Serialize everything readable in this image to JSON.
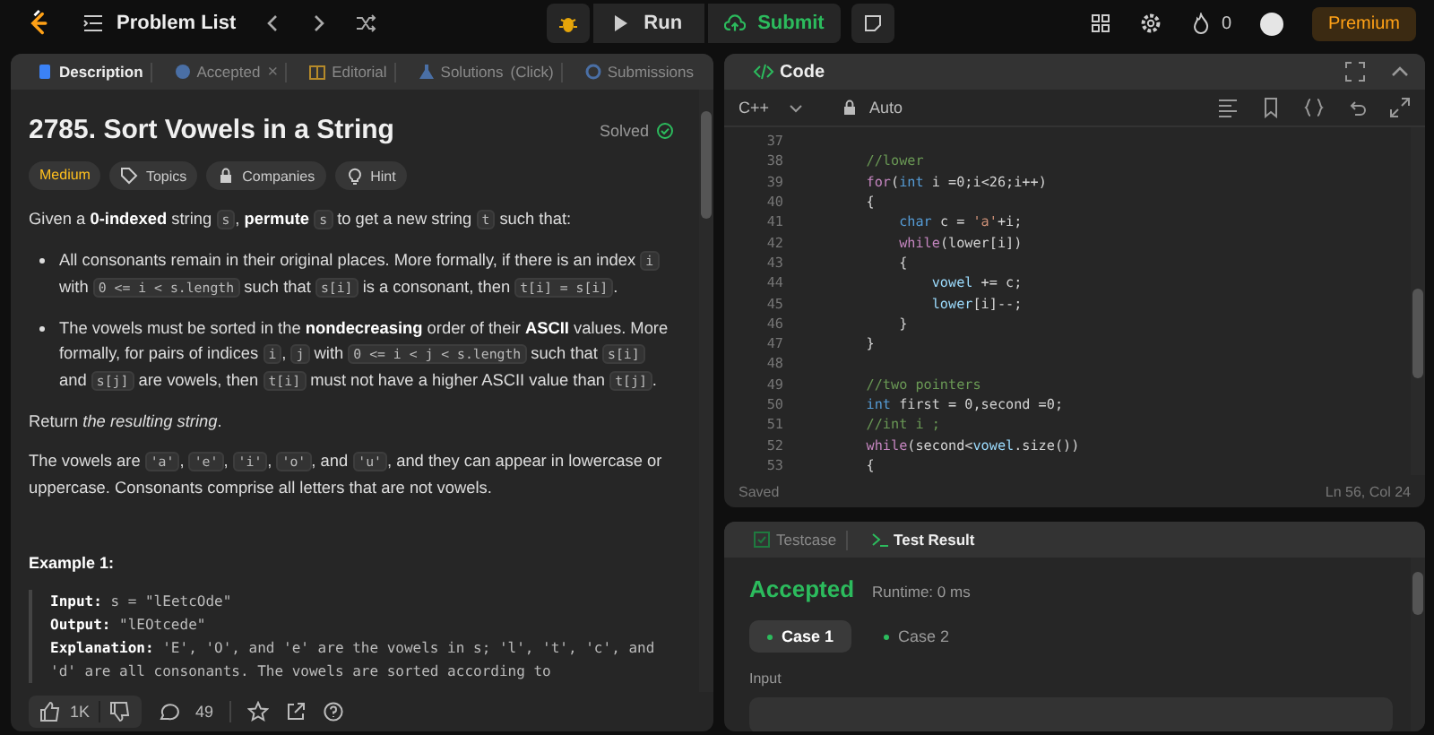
{
  "top_bar": {
    "nav_label": "Problem List",
    "run_label": "Run",
    "submit_label": "Submit",
    "streak": "0",
    "premium_label": "Premium"
  },
  "description_panel": {
    "tabs": [
      {
        "label": "Description",
        "selected": true,
        "kind": "description"
      },
      {
        "label": "Accepted",
        "selected": false,
        "kind": "accepted",
        "close_label": "×"
      },
      {
        "label": "Editorial",
        "selected": false,
        "kind": "editorial"
      },
      {
        "label": "Solutions",
        "selected": false,
        "kind": "solutions",
        "extra": "(Click)"
      },
      {
        "label": "Submissions",
        "selected": false,
        "kind": "submissions"
      }
    ],
    "title": "2785. Sort Vowels in a String",
    "status": "Solved",
    "tags": [
      {
        "label": "Medium",
        "kind": "difficulty"
      },
      {
        "label": "Topics",
        "kind": "topics"
      },
      {
        "label": "Companies",
        "kind": "companies"
      },
      {
        "label": "Hint",
        "kind": "hint"
      }
    ],
    "blocks": [
      {
        "kind": "paragraph",
        "segments": [
          {
            "text": "Given a ",
            "kind": "plain"
          },
          {
            "text": "0-indexed",
            "kind": "bold"
          },
          {
            "text": " string ",
            "kind": "plain"
          },
          {
            "text": "s",
            "kind": "code"
          },
          {
            "text": ", ",
            "kind": "plain"
          },
          {
            "text": "permute ",
            "kind": "bold"
          },
          {
            "text": "s",
            "kind": "code"
          },
          {
            "text": " to get a new string ",
            "kind": "plain"
          },
          {
            "text": "t",
            "kind": "code"
          },
          {
            "text": " such that:",
            "kind": "plain"
          }
        ]
      },
      {
        "kind": "bullet",
        "segments": [
          {
            "text": "All consonants remain in their original places. More formally, if there is an index ",
            "kind": "plain"
          },
          {
            "text": "i",
            "kind": "code"
          },
          {
            "text": " with ",
            "kind": "plain"
          },
          {
            "text": "0 <= i < s.length",
            "kind": "code"
          },
          {
            "text": " such that ",
            "kind": "plain"
          },
          {
            "text": "s[i]",
            "kind": "code"
          },
          {
            "text": " is a consonant, then ",
            "kind": "plain"
          },
          {
            "text": "t[i] = s[i]",
            "kind": "code"
          },
          {
            "text": ".",
            "kind": "plain"
          }
        ]
      },
      {
        "kind": "bullet",
        "segments": [
          {
            "text": "The vowels must be sorted in the ",
            "kind": "plain"
          },
          {
            "text": "nondecreasing",
            "kind": "bold"
          },
          {
            "text": " order of their ",
            "kind": "plain"
          },
          {
            "text": "ASCII",
            "kind": "bold"
          },
          {
            "text": " values. More formally, for pairs of indices ",
            "kind": "plain"
          },
          {
            "text": "i",
            "kind": "code"
          },
          {
            "text": ", ",
            "kind": "plain"
          },
          {
            "text": "j",
            "kind": "code"
          },
          {
            "text": " with ",
            "kind": "plain"
          },
          {
            "text": "0 <= i < j < s.length",
            "kind": "code"
          },
          {
            "text": " such that ",
            "kind": "plain"
          },
          {
            "text": "s[i]",
            "kind": "code"
          },
          {
            "text": " and ",
            "kind": "plain"
          },
          {
            "text": "s[j]",
            "kind": "code"
          },
          {
            "text": " are vowels, then ",
            "kind": "plain"
          },
          {
            "text": "t[i]",
            "kind": "code"
          },
          {
            "text": " must not have a higher ASCII value than ",
            "kind": "plain"
          },
          {
            "text": "t[j]",
            "kind": "code"
          },
          {
            "text": ".",
            "kind": "plain"
          }
        ]
      },
      {
        "kind": "paragraph",
        "segments": [
          {
            "text": "Return ",
            "kind": "plain"
          },
          {
            "text": "the resulting string",
            "kind": "italic"
          },
          {
            "text": ".",
            "kind": "plain"
          }
        ]
      },
      {
        "kind": "paragraph",
        "segments": [
          {
            "text": "The vowels are ",
            "kind": "plain"
          },
          {
            "text": "'a'",
            "kind": "code"
          },
          {
            "text": ", ",
            "kind": "plain"
          },
          {
            "text": "'e'",
            "kind": "code"
          },
          {
            "text": ", ",
            "kind": "plain"
          },
          {
            "text": "'i'",
            "kind": "code"
          },
          {
            "text": ", ",
            "kind": "plain"
          },
          {
            "text": "'o'",
            "kind": "code"
          },
          {
            "text": ", and ",
            "kind": "plain"
          },
          {
            "text": "'u'",
            "kind": "code"
          },
          {
            "text": ", and they can appear in lowercase or uppercase. Consonants comprise all letters that are not vowels.",
            "kind": "plain"
          }
        ]
      }
    ],
    "example": {
      "title": "Example 1:",
      "lines": [
        {
          "label": "Input:",
          "text": "s = \"lEetcOde\""
        },
        {
          "label": "Output:",
          "text": "\"lEOtcede\""
        },
        {
          "label": "Explanation:",
          "text": "'E', 'O', and 'e' are the vowels in s; 'l', 't', 'c', and 'd' are all consonants. The vowels are sorted according to"
        }
      ]
    },
    "footer": {
      "likes": "1K",
      "comments": "49"
    }
  },
  "code_panel": {
    "title": "Code",
    "language": "C++",
    "mode": "Auto",
    "lines": [
      {
        "number": "37"
      },
      {
        "number": "38",
        "segments": [
          {
            "text": "    //lower",
            "kind": "comment"
          }
        ]
      },
      {
        "number": "39",
        "segments": [
          {
            "text": "    for",
            "kind": "control"
          },
          {
            "text": "(",
            "kind": "plain"
          },
          {
            "text": "int",
            "kind": "keyword"
          },
          {
            "text": " i =0;i<26;i++)",
            "kind": "plain"
          }
        ]
      },
      {
        "number": "40",
        "segments": [
          {
            "text": "    {",
            "kind": "plain"
          }
        ]
      },
      {
        "number": "41",
        "segments": [
          {
            "text": "        char",
            "kind": "keyword"
          },
          {
            "text": " c = ",
            "kind": "plain"
          },
          {
            "text": "'a'",
            "kind": "string"
          },
          {
            "text": "+i;",
            "kind": "plain"
          }
        ]
      },
      {
        "number": "42",
        "segments": [
          {
            "text": "        while",
            "kind": "control"
          },
          {
            "text": "(lower[i])",
            "kind": "plain"
          }
        ]
      },
      {
        "number": "43",
        "segments": [
          {
            "text": "        {",
            "kind": "plain"
          }
        ]
      },
      {
        "number": "44",
        "segments": [
          {
            "text": "            vowel",
            "kind": "variable"
          },
          {
            "text": " += c;",
            "kind": "plain"
          }
        ]
      },
      {
        "number": "45",
        "segments": [
          {
            "text": "            lower",
            "kind": "variable"
          },
          {
            "text": "[i]--;",
            "kind": "plain"
          }
        ]
      },
      {
        "number": "46",
        "segments": [
          {
            "text": "        }",
            "kind": "plain"
          }
        ]
      },
      {
        "number": "47",
        "segments": [
          {
            "text": "    }",
            "kind": "plain"
          }
        ]
      },
      {
        "number": "48"
      },
      {
        "number": "49",
        "segments": [
          {
            "text": "    //two pointers",
            "kind": "comment"
          }
        ]
      },
      {
        "number": "50",
        "segments": [
          {
            "text": "    int",
            "kind": "keyword"
          },
          {
            "text": " first = 0,second =0;",
            "kind": "plain"
          }
        ]
      },
      {
        "number": "51",
        "segments": [
          {
            "text": "    //int i ;",
            "kind": "comment"
          }
        ]
      },
      {
        "number": "52",
        "segments": [
          {
            "text": "    while",
            "kind": "control"
          },
          {
            "text": "(second<",
            "kind": "plain"
          },
          {
            "text": "vowel",
            "kind": "variable"
          },
          {
            "text": ".size())",
            "kind": "plain"
          }
        ]
      },
      {
        "number": "53",
        "segments": [
          {
            "text": "    {",
            "kind": "plain"
          }
        ]
      }
    ],
    "save_status": "Saved",
    "cursor": "Ln 56, Col 24"
  },
  "result_panel": {
    "tabs": [
      {
        "label": "Testcase",
        "selected": false,
        "kind": "testcase"
      },
      {
        "label": "Test Result",
        "selected": true,
        "kind": "result"
      }
    ],
    "verdict": "Accepted",
    "runtime": "Runtime: 0 ms",
    "cases": [
      {
        "label": "Case 1",
        "selected": true
      },
      {
        "label": "Case 2",
        "selected": false
      }
    ],
    "input_label": "Input"
  }
}
